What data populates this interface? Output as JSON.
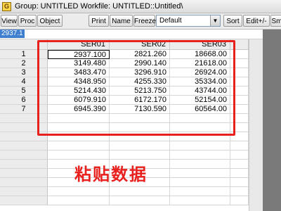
{
  "titlebar": {
    "icon_letter": "G",
    "text": "Group: UNTITLED   Workfile: UNTITLED::Untitled\\"
  },
  "toolbar": {
    "view": "View",
    "proc": "Proc",
    "object": "Object",
    "print": "Print",
    "name": "Name",
    "freeze": "Freeze",
    "dropdown_value": "Default",
    "sort": "Sort",
    "edit": "Edit+/-",
    "smpl": "Sm"
  },
  "editbar": {
    "value": "2937.1"
  },
  "table": {
    "columns": [
      "SER01",
      "SER02",
      "SER03"
    ],
    "rows": [
      {
        "label": "1",
        "values": [
          "2937.100",
          "2821.260",
          "18668.00"
        ]
      },
      {
        "label": "2",
        "values": [
          "3149.480",
          "2990.140",
          "21618.00"
        ]
      },
      {
        "label": "3",
        "values": [
          "3483.470",
          "3296.910",
          "26924.00"
        ]
      },
      {
        "label": "4",
        "values": [
          "4348.950",
          "4255.330",
          "35334.00"
        ]
      },
      {
        "label": "5",
        "values": [
          "5214.430",
          "5213.750",
          "43744.00"
        ]
      },
      {
        "label": "6",
        "values": [
          "6079.910",
          "6172.170",
          "52154.00"
        ]
      },
      {
        "label": "7",
        "values": [
          "6945.390",
          "7130.590",
          "60564.00"
        ]
      }
    ]
  },
  "annotation": {
    "caption": "粘贴数据",
    "color": "#e8201e"
  }
}
